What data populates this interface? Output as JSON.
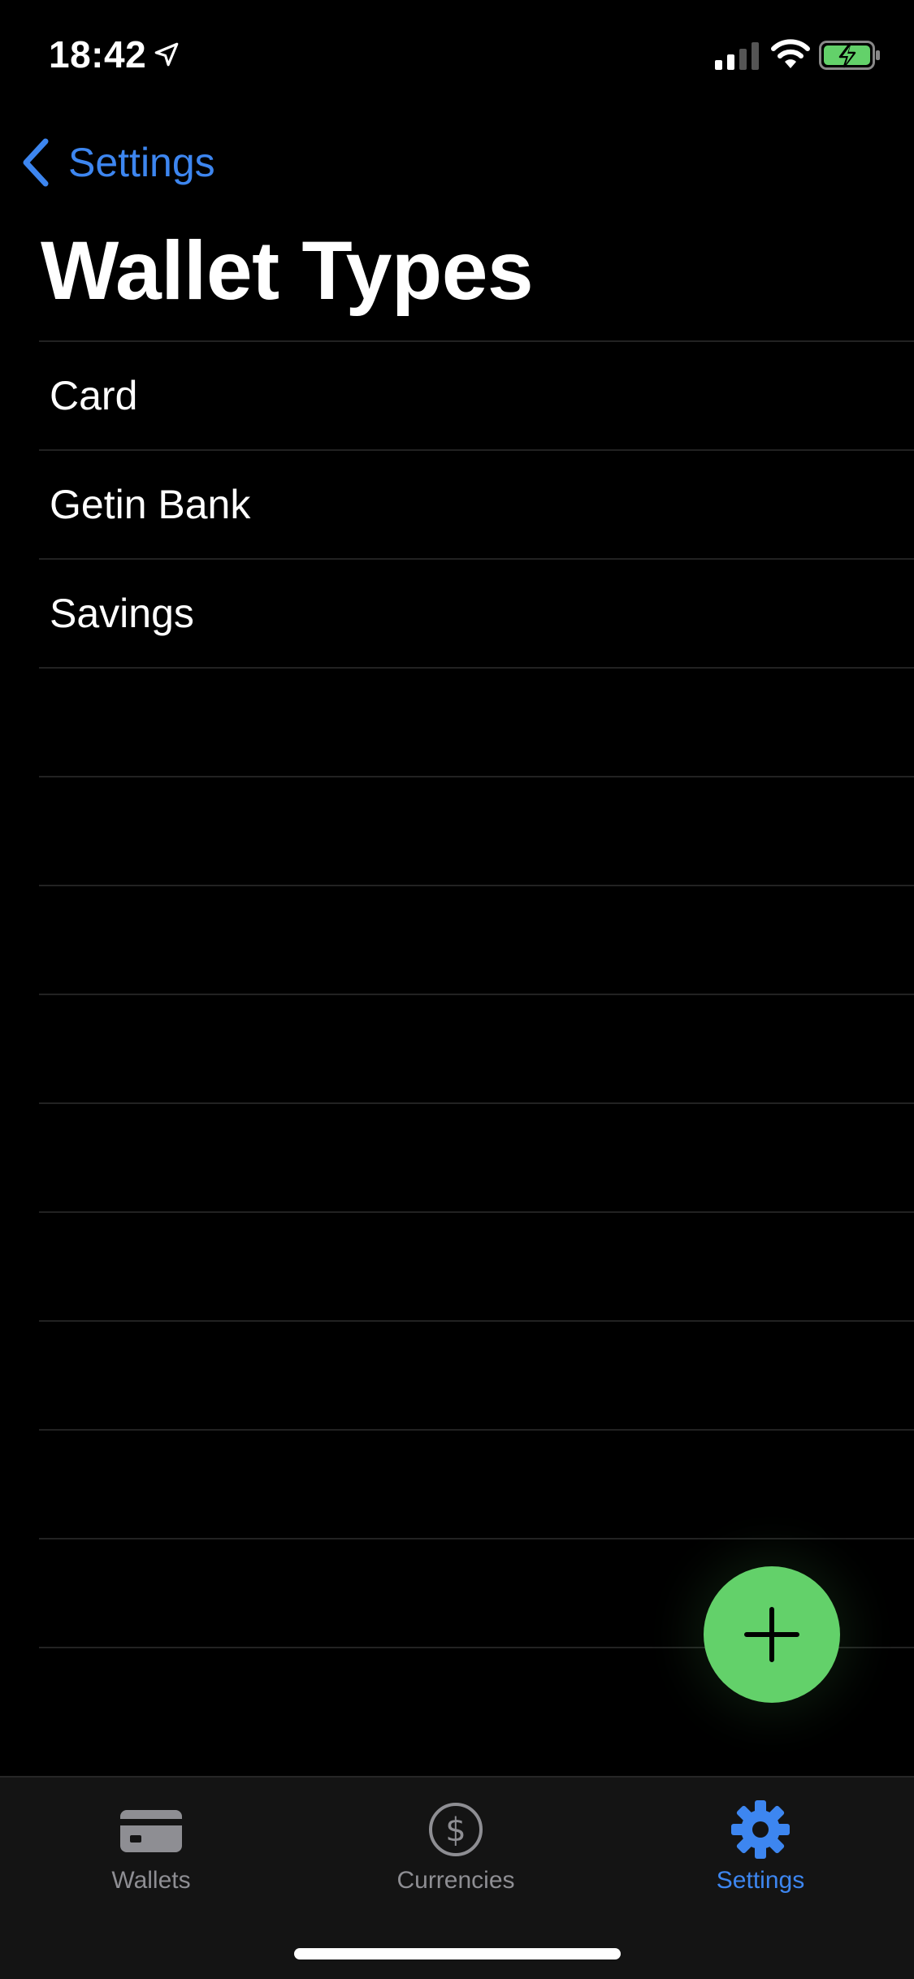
{
  "status_bar": {
    "time": "18:42"
  },
  "nav": {
    "back_label": "Settings",
    "title": "Wallet Types"
  },
  "list": {
    "items": [
      "Card",
      "Getin Bank",
      "Savings",
      "",
      "",
      "",
      "",
      "",
      "",
      "",
      "",
      "",
      ""
    ]
  },
  "fab": {
    "icon": "plus-icon",
    "color": "#63d16a"
  },
  "tab_bar": {
    "tabs": [
      {
        "label": "Wallets",
        "icon": "credit-card-icon",
        "active": false
      },
      {
        "label": "Currencies",
        "icon": "dollar-circle-icon",
        "active": false
      },
      {
        "label": "Settings",
        "icon": "gear-icon",
        "active": true
      }
    ]
  },
  "colors": {
    "accent": "#3d86f0",
    "background": "#000000",
    "inactive": "#8e8e93"
  }
}
